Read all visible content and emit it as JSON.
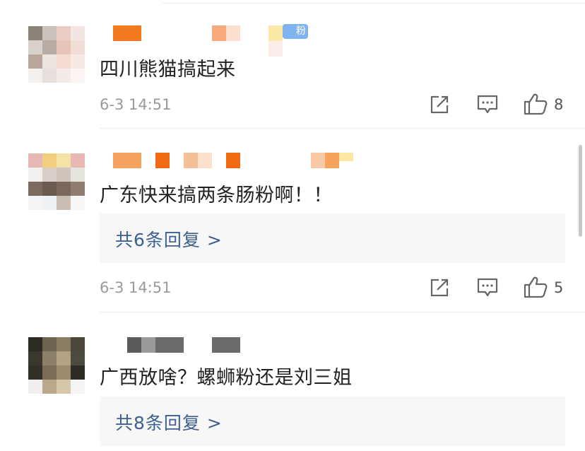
{
  "comments": [
    {
      "text": "四川熊猫搞起来",
      "badge": "粉",
      "time": "6-3 14:51",
      "likes": "8"
    },
    {
      "text": "广东快来搞两条肠粉啊！！",
      "replies_label": "共6条回复 >",
      "time": "6-3 14:51",
      "likes": "5"
    },
    {
      "text": "广西放啥？螺蛳粉还是刘三姐",
      "replies_label": "共8条回复 >"
    }
  ],
  "icons": [
    "share-icon",
    "comment-icon",
    "like-icon"
  ],
  "colors": {
    "reply_link": "#3c6090",
    "reply_bg": "#f7f7f7",
    "fan_badge": "#7fb3f0",
    "name_blur_orange": "#f47a20"
  }
}
